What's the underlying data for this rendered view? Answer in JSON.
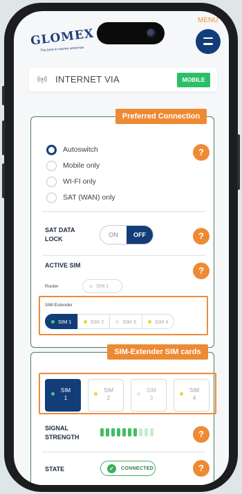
{
  "header": {
    "logo_text": "GLOMEX",
    "logo_tagline": "The best in marine antennas",
    "menu_label": "MENU"
  },
  "internet": {
    "label": "INTERNET VIA",
    "badge": "MOBILE",
    "icon": "antenna-icon"
  },
  "preferred": {
    "title": "Preferred Connection",
    "options": [
      "Autoswitch",
      "Mobile only",
      "WI-FI only",
      "SAT (WAN) only"
    ],
    "selected": "Autoswitch",
    "help": "?",
    "sat_lock": {
      "label_line1": "SAT DATA",
      "label_line2": "LOCK",
      "on": "ON",
      "off": "OFF",
      "value": "OFF"
    },
    "active_sim": {
      "label": "ACTIVE SIM",
      "router_label": "Router",
      "router_sim": "SIM 1",
      "extender_label": "SIM-Extender",
      "extender_sims": [
        "SIM 1",
        "SIM 2",
        "SIM 3",
        "SIM 4"
      ],
      "extender_selected": "SIM 1"
    }
  },
  "extender_cards": {
    "title": "SIM-Extender SIM cards",
    "cards": [
      {
        "line1": "SIM",
        "line2": "1"
      },
      {
        "line1": "SIM",
        "line2": "2"
      },
      {
        "line1": "SIM",
        "line2": "3"
      },
      {
        "line1": "SIM",
        "line2": "4"
      }
    ],
    "selected": "SIM 1",
    "signal": {
      "label_line1": "SIGNAL",
      "label_line2": "STRENGTH",
      "bars_total": 10,
      "bars_filled": 7
    },
    "state": {
      "label": "STATE",
      "value": "CONNECTED"
    },
    "help": "?"
  },
  "colors": {
    "navy": "#133d78",
    "orange": "#ef8a34",
    "green": "#2cbf6b",
    "yellow": "#f2d335"
  }
}
